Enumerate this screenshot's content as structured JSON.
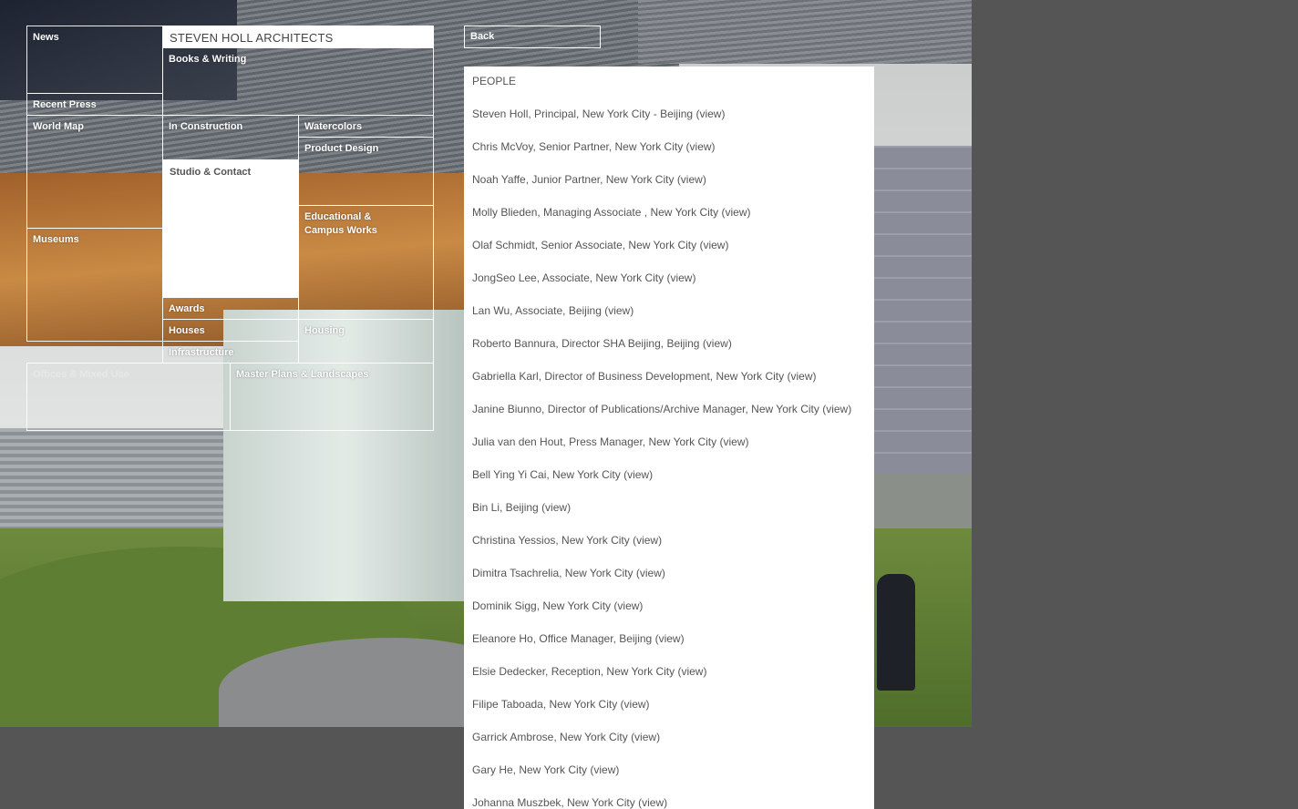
{
  "brand": "STEVEN HOLL ARCHITECTS",
  "nav": {
    "news": "News",
    "recent_press": "Recent Press",
    "world_map": "World Map",
    "museums": "Museums",
    "books_writing": "Books & Writing",
    "in_construction": "In Construction",
    "studio_contact": "Studio & Contact",
    "awards": "Awards",
    "houses": "Houses",
    "infrastructure": "Infrastructure",
    "watercolors": "Watercolors",
    "product_design": "Product Design",
    "educational_campus": "Educational & Campus Works",
    "housing": "Housing",
    "offices_mixed_use": "Offices & Mixed Use",
    "master_plans": "Master Plans & Landscapes"
  },
  "back_label": "Back",
  "people_title": "PEOPLE",
  "people": [
    {
      "text": "Steven Holl, Principal, New York City - Beijing",
      "link": "(view)"
    },
    {
      "text": "Chris McVoy, Senior Partner, New York City",
      "link": "(view)"
    },
    {
      "text": "Noah Yaffe, Junior Partner, New York City",
      "link": "(view)"
    },
    {
      "text": "Molly Blieden, Managing Associate , New York City",
      "link": "(view)"
    },
    {
      "text": "Olaf Schmidt, Senior Associate, New York City",
      "link": "(view)"
    },
    {
      "text": "JongSeo Lee, Associate, New York City",
      "link": "(view)"
    },
    {
      "text": "Lan Wu, Associate, Beijing",
      "link": "(view)"
    },
    {
      "text": "Roberto Bannura, Director SHA Beijing, Beijing",
      "link": "(view)"
    },
    {
      "text": "Gabriella Karl, Director of Business Development, New York City",
      "link": "(view)"
    },
    {
      "text": "Janine Biunno, Director of Publications/Archive Manager, New York City",
      "link": "(view)"
    },
    {
      "text": "Julia van den Hout, Press Manager, New York City",
      "link": "(view)"
    },
    {
      "text": "Bell Ying Yi Cai, New York City",
      "link": "(view)"
    },
    {
      "text": "Bin Li, Beijing",
      "link": "(view)"
    },
    {
      "text": "Christina Yessios, New York City",
      "link": "(view)"
    },
    {
      "text": "Dimitra Tsachrelia, New York City",
      "link": "(view)"
    },
    {
      "text": "Dominik Sigg, New York City",
      "link": "(view)"
    },
    {
      "text": "Eleanore Ho, Office Manager, Beijing",
      "link": "(view)"
    },
    {
      "text": "Elsie Dedecker, Reception, New York City",
      "link": "(view)"
    },
    {
      "text": "Filipe Taboada, New York City",
      "link": "(view)"
    },
    {
      "text": "Garrick Ambrose, New York City",
      "link": "(view)"
    },
    {
      "text": "Gary He, New York City",
      "link": "(view)"
    },
    {
      "text": "Johanna Muszbek, New York City",
      "link": "(view)"
    }
  ]
}
